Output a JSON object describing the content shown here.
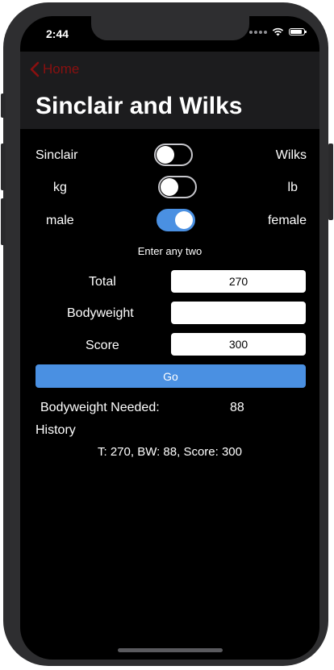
{
  "status_bar": {
    "time": "2:44"
  },
  "nav": {
    "back_label": "Home",
    "title": "Sinclair and Wilks"
  },
  "toggles": {
    "formula": {
      "left": "Sinclair",
      "right": "Wilks",
      "on": false
    },
    "unit": {
      "left": "kg",
      "right": "lb",
      "on": false
    },
    "sex": {
      "left": "male",
      "right": "female",
      "on": true
    }
  },
  "hint": "Enter any two",
  "fields": {
    "total": {
      "label": "Total",
      "value": "270"
    },
    "bodyweight": {
      "label": "Bodyweight",
      "value": ""
    },
    "score": {
      "label": "Score",
      "value": "300"
    }
  },
  "go_label": "Go",
  "result": {
    "label": "Bodyweight Needed:",
    "value": "88"
  },
  "history": {
    "label": "History",
    "entries": [
      "T: 270, BW: 88, Score: 300"
    ]
  },
  "colors": {
    "accent": "#4a90e2",
    "back_tint": "#8a1010",
    "navbar": "#1c1c1e"
  }
}
